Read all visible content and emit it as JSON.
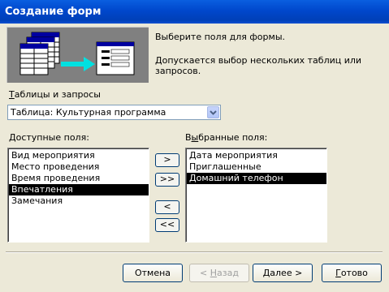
{
  "window": {
    "title": "Создание форм"
  },
  "description": {
    "line1": "Выберите поля для формы.",
    "line2": "Допускается выбор нескольких таблиц или запросов."
  },
  "source": {
    "label_accel": "Т",
    "label_rest": "аблицы и запросы",
    "selected": "Таблица: Культурная программа"
  },
  "available": {
    "label_accel": "Д",
    "label_rest": "оступные поля:",
    "items": [
      "Вид мероприятия",
      "Место проведения",
      "Время проведения",
      "Впечатления",
      "Замечания"
    ],
    "selected_index": 3
  },
  "chosen": {
    "label_pre": "В",
    "label_accel": "ы",
    "label_rest": "бранные поля:",
    "items": [
      "Дата мероприятия",
      "Приглашенные",
      "Домашний телефон"
    ],
    "selected_index": 2
  },
  "move_buttons": {
    "add_one": ">",
    "add_all": ">>",
    "remove_one": "<",
    "remove_all": "<<"
  },
  "buttons": {
    "cancel": "Отмена",
    "back_pre": "< ",
    "back_accel": "Н",
    "back_rest": "азад",
    "next_accel": "Д",
    "next_rest": "алее >",
    "finish_accel": "Г",
    "finish_rest": "отово"
  },
  "colors": {
    "titlebar": "#0047cc",
    "dialog_bg": "#ece9d8",
    "illustration_bg": "#808080",
    "arrow": "#00e0e0"
  },
  "icons": {
    "illustration": "wizard-tables-to-form-illustration",
    "combo_arrow": "chevron-down-icon"
  }
}
